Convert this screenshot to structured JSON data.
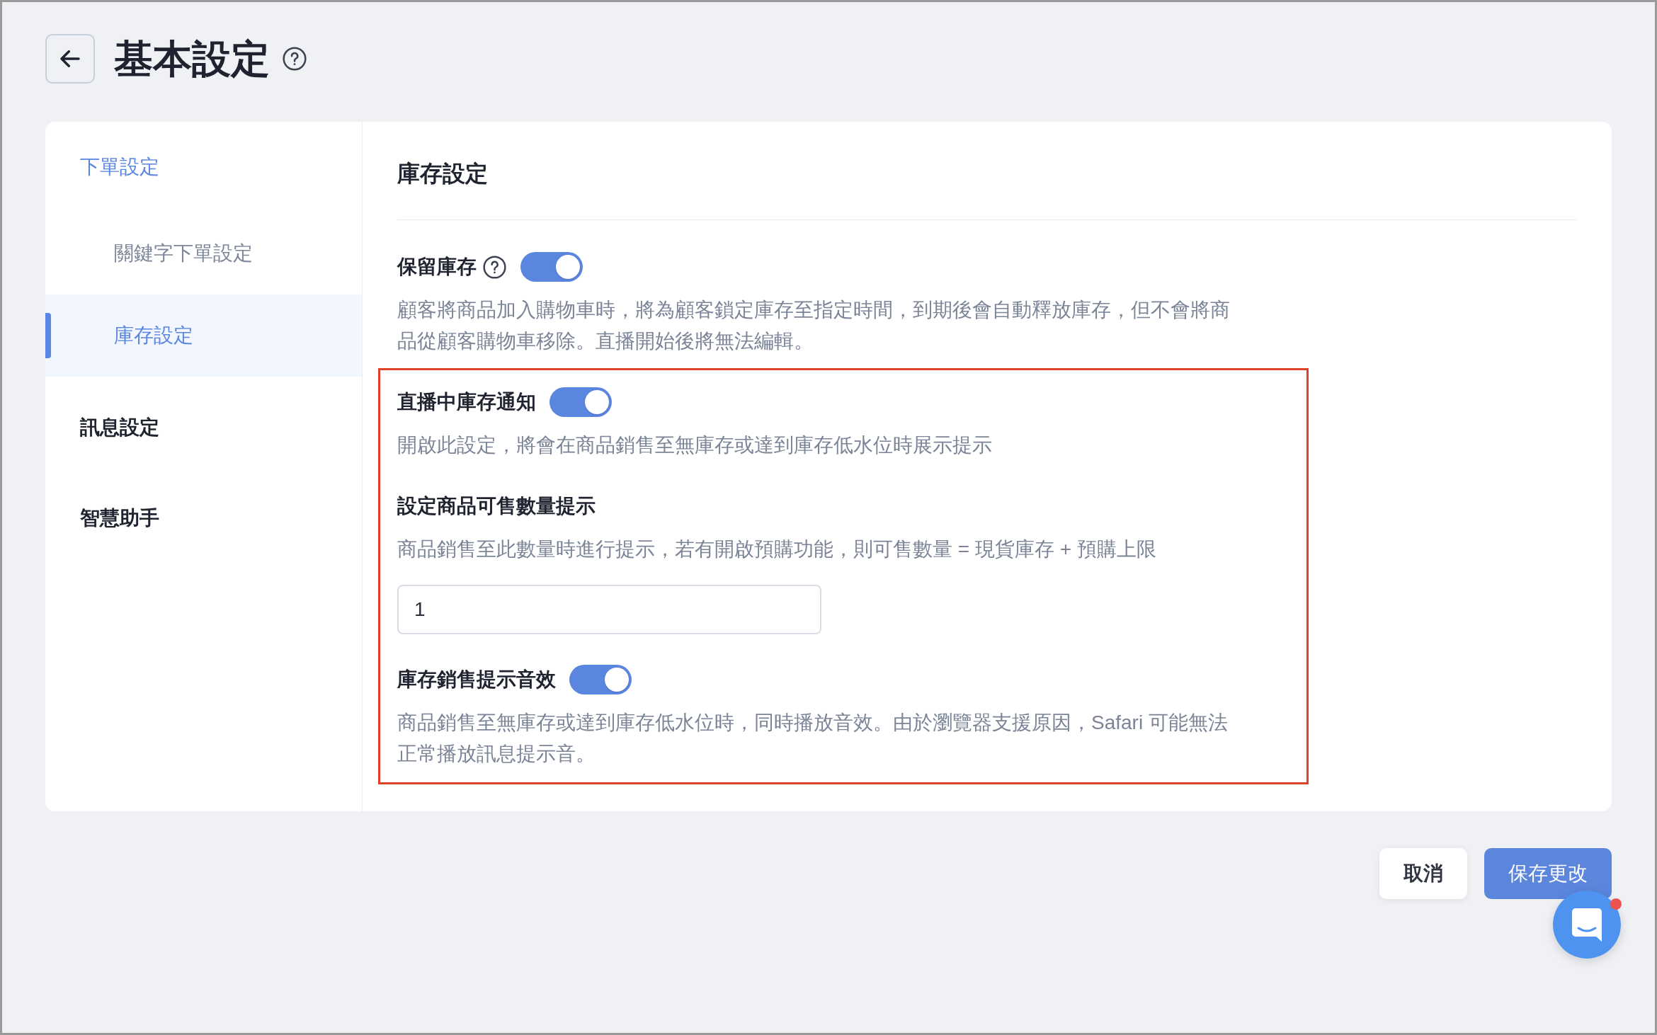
{
  "header": {
    "title": "基本設定"
  },
  "sidebar": {
    "items": [
      {
        "label": "下單設定",
        "selected": false,
        "children": [
          {
            "label": "關鍵字下單設定",
            "selected": false
          },
          {
            "label": "庫存設定",
            "selected": true
          }
        ]
      },
      {
        "label": "訊息設定",
        "selected": false
      },
      {
        "label": "智慧助手",
        "selected": false
      }
    ]
  },
  "panel": {
    "title": "庫存設定",
    "settings": [
      {
        "kind": "toggle",
        "label": "保留庫存",
        "help": true,
        "on": true,
        "highlighted": false,
        "description": "顧客將商品加入購物車時，將為顧客鎖定庫存至指定時間，到期後會自動釋放庫存，但不會將商品從顧客購物車移除。直播開始後將無法編輯。"
      },
      {
        "kind": "toggle",
        "label": "直播中庫存通知",
        "help": false,
        "on": true,
        "highlighted": true,
        "description": "開啟此設定，將會在商品銷售至無庫存或達到庫存低水位時展示提示"
      },
      {
        "kind": "number",
        "label": "設定商品可售數量提示",
        "help": false,
        "highlighted": true,
        "description": "商品銷售至此數量時進行提示，若有開啟預購功能，則可售數量 = 現貨庫存 + 預購上限",
        "value": "1"
      },
      {
        "kind": "toggle",
        "label": "庫存銷售提示音效",
        "help": false,
        "on": true,
        "highlighted": true,
        "description": "商品銷售至無庫存或達到庫存低水位時，同時播放音效。由於瀏覽器支援原因，Safari 可能無法正常播放訊息提示音。"
      }
    ]
  },
  "footer": {
    "buttons": [
      {
        "label": "取消",
        "kind": "secondary"
      },
      {
        "label": "保存更改",
        "kind": "primary"
      }
    ]
  },
  "chat_widget": {
    "unread": true
  }
}
